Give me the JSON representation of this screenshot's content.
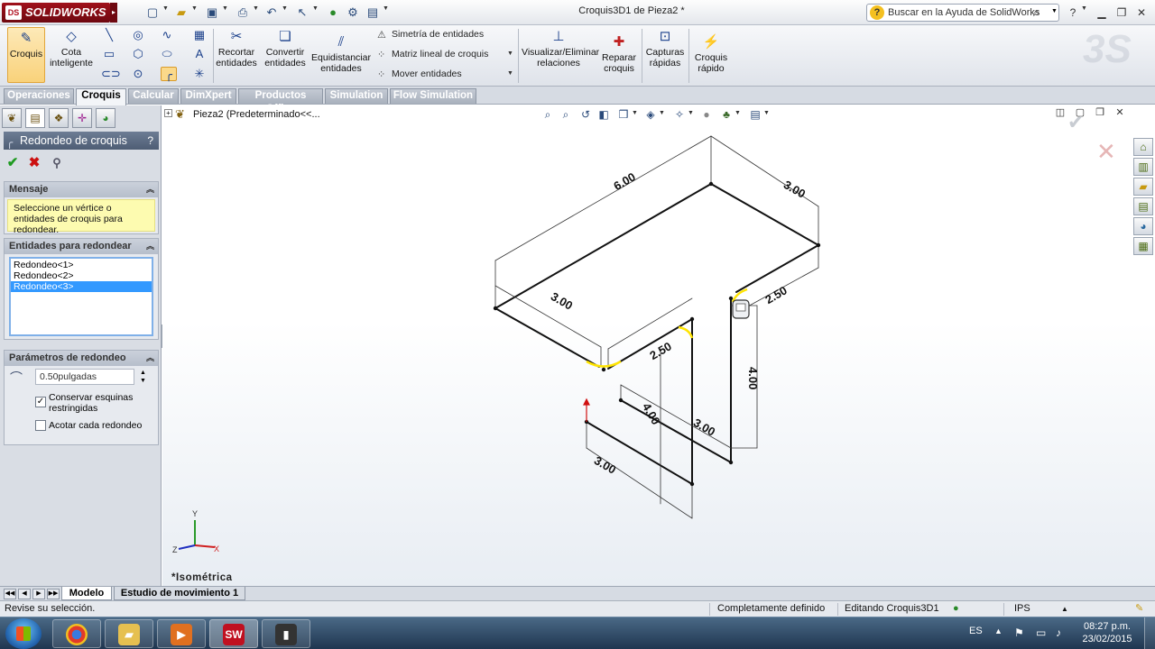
{
  "app": {
    "logo_text": "SOLIDWORKS",
    "logo_mark": "DS",
    "window_title": "Croquis3D1 de Pieza2 *",
    "help_search_placeholder": "Buscar en la Ayuda de SolidWorks",
    "help_icon": "question-icon",
    "window_controls": [
      "minimize-icon",
      "maximize-icon",
      "close-icon"
    ]
  },
  "quick_access": [
    "new-document-icon",
    "open-icon",
    "save-icon",
    "print-icon",
    "undo-icon",
    "select-icon",
    "traffic-light-icon",
    "options-icon",
    "file-properties-icon"
  ],
  "ribbon": {
    "croquis": "Croquis",
    "cota_inteligente": "Cota inteligente",
    "recortar_entidades": "Recortar entidades",
    "convertir_entidades": "Convertir entidades",
    "equidistanciar_entidades": "Equidistanciar entidades",
    "simetria": "Simetría de entidades",
    "matriz": "Matriz lineal de croquis",
    "mover": "Mover entidades",
    "visualizar_relaciones": "Visualizar/Eliminar relaciones",
    "reparar_croquis": "Reparar croquis",
    "capturas_rapidas": "Capturas rápidas",
    "croquis_rapido": "Croquis rápido"
  },
  "tabs": [
    "Operaciones",
    "Croquis",
    "Calcular",
    "DimXpert",
    "Productos Office",
    "Simulation",
    "Flow Simulation"
  ],
  "active_tab": "Croquis",
  "property_manager": {
    "title": "Redondeo de croquis",
    "help": "?",
    "mensaje_header": "Mensaje",
    "mensaje_text": "Seleccione un vértice o entidades de croquis para redondear.",
    "entidades_header": "Entidades para redondear",
    "entidades": [
      "Redondeo<1>",
      "Redondeo<2>",
      "Redondeo<3>"
    ],
    "selected_entity_index": 2,
    "parametros_header": "Parámetros de redondeo",
    "radius_value": "0.50pulgadas",
    "conservar_label": "Conservar esquinas restringidas",
    "conservar_checked": true,
    "acotar_label": "Acotar cada redondeo",
    "acotar_checked": false
  },
  "feature_tree": {
    "root_part": "Pieza2",
    "root_config": "(Predeterminado<<..."
  },
  "viewport": {
    "view_name": "*Isométrica",
    "triad_labels": {
      "x": "X",
      "y": "Y",
      "z": "Z"
    },
    "dimensions": [
      "6.00",
      "3.00",
      "3.00",
      "2.50",
      "2.50",
      "4.00",
      "4.00",
      "3.00",
      "3.00"
    ]
  },
  "bottom_tabs": [
    "Modelo",
    "Estudio de movimiento 1"
  ],
  "status": {
    "message": "Revise su selección.",
    "definition": "Completamente definido",
    "editing": "Editando Croquis3D1",
    "units": "IPS"
  },
  "taskbar": {
    "apps": [
      "chrome-icon",
      "file-explorer-icon",
      "media-player-icon",
      "solidworks-icon",
      "command-prompt-icon"
    ],
    "lang": "ES",
    "time": "08:27 p.m.",
    "date": "23/02/2015"
  },
  "colors": {
    "pm_title_bg": "#5a6a82",
    "message_bg": "#fdfbb0",
    "selected_item": "#3399ff",
    "fillet_highlight": "#ffe400",
    "sw_red": "#a0101a"
  }
}
